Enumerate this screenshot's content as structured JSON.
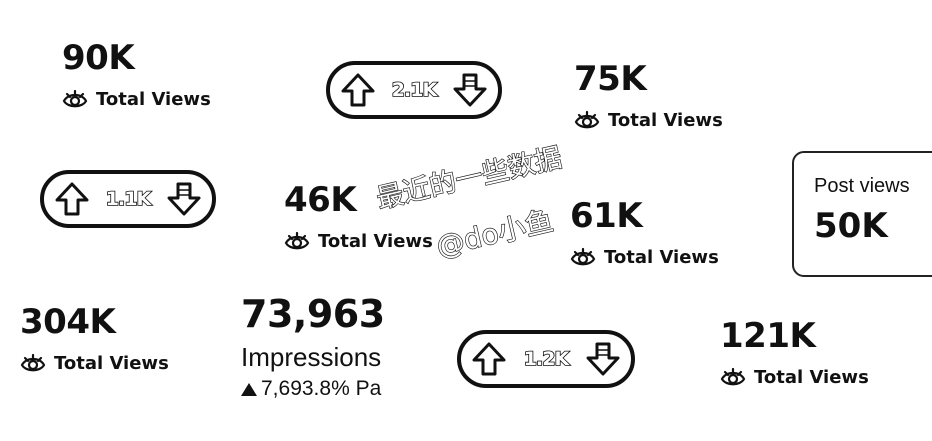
{
  "stats": [
    {
      "value": "90K",
      "label": "Total Views"
    },
    {
      "value": "75K",
      "label": "Total Views"
    },
    {
      "value": "46K",
      "label": "Total Views"
    },
    {
      "value": "61K",
      "label": "Total Views"
    },
    {
      "value": "304K",
      "label": "Total Views"
    },
    {
      "value": "121K",
      "label": "Total Views"
    }
  ],
  "vote_pills": [
    {
      "count": "2.1K",
      "up_icon": "upvote-arrow-icon",
      "down_icon": "downvote-arrow-icon"
    },
    {
      "count": "1.1K",
      "up_icon": "upvote-arrow-icon",
      "down_icon": "downvote-arrow-icon"
    },
    {
      "count": "1.2K",
      "up_icon": "upvote-arrow-icon",
      "down_icon": "downvote-arrow-icon"
    }
  ],
  "post_views_card": {
    "label": "Post views",
    "value": "50K"
  },
  "impressions": {
    "value": "73,963",
    "label": "Impressions",
    "change": "7,693.8% Pa"
  },
  "watermark": {
    "line1": "最近的一些数据",
    "line2": "@do小鱼"
  },
  "icons": {
    "views": "eye-icon",
    "change": "triangle-up-icon"
  }
}
